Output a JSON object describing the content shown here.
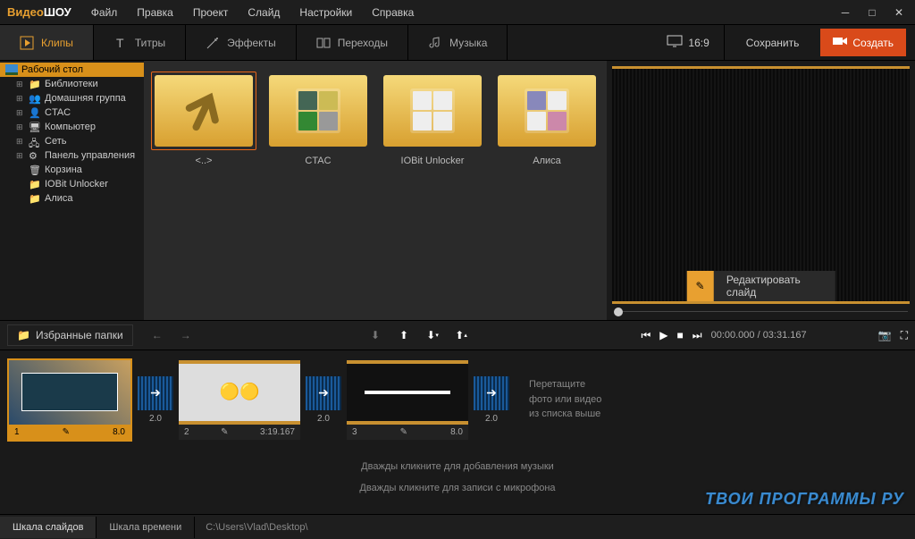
{
  "app": {
    "logo1": "Видео",
    "logo2": "ШОУ"
  },
  "menu": [
    "Файл",
    "Правка",
    "Проект",
    "Слайд",
    "Настройки",
    "Справка"
  ],
  "tabs": {
    "clips": "Клипы",
    "titles": "Титры",
    "effects": "Эффекты",
    "transitions": "Переходы",
    "music": "Музыка"
  },
  "aspect": "16:9",
  "save": "Сохранить",
  "create": "Создать",
  "sidebar": {
    "root": "Рабочий стол",
    "items": [
      "Библиотеки",
      "Домашняя группа",
      "CTAC",
      "Компьютер",
      "Сеть",
      "Панель управления",
      "Корзина",
      "IOBit Unlocker",
      "Алиса"
    ]
  },
  "folders": [
    "<..>",
    "CTAC",
    "IOBit Unlocker",
    "Алиса"
  ],
  "edit_slide": "Редактировать слайд",
  "fav_folders": "Избранные папки",
  "playback": {
    "current": "00:00.000",
    "total": "03:31.167"
  },
  "timeline": {
    "slides": [
      {
        "num": "1",
        "dur": "8.0"
      },
      {
        "num": "2",
        "dur": "3:19.167"
      },
      {
        "num": "3",
        "dur": "8.0"
      }
    ],
    "trans_dur": "2.0",
    "hint1": "Перетащите",
    "hint2": "фото или видео",
    "hint3": "из списка выше"
  },
  "audio": {
    "music_hint": "Дважды кликните для добавления музыки",
    "mic_hint": "Дважды кликните для записи с микрофона"
  },
  "bottom": {
    "tab1": "Шкала слайдов",
    "tab2": "Шкала времени",
    "path": "C:\\Users\\Vlad\\Desktop\\"
  },
  "watermark": "ТВОИ ПРОГРАММЫ РУ"
}
